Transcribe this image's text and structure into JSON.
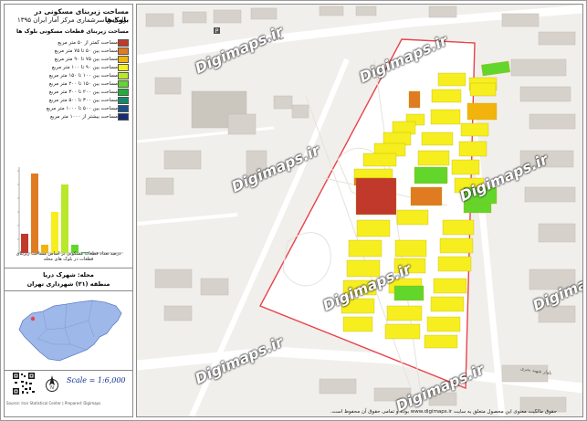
{
  "title": {
    "line1": "مساحت زیربنای مسکونی در بلوک‌ها",
    "line2": "براساس سرشماری مرکز آمار ایران ۱۳۹۵"
  },
  "legend": {
    "title": "مساحت زیربنای قطعات مسکونی بلوک ها",
    "items": [
      {
        "label": "مساحت کمتر از ۵۰ متر مربع",
        "color": "#c0392b"
      },
      {
        "label": "مساحت بین ۵۰ تا ۷۵ متر مربع",
        "color": "#e07b21"
      },
      {
        "label": "مساحت بین ۷۵ تا ۹۰ متر مربع",
        "color": "#f2b40c"
      },
      {
        "label": "مساحت بین ۹۰ تا ۱۰۰ متر مربع",
        "color": "#f6ee1e"
      },
      {
        "label": "مساحت بین ۱۰۰ تا ۱۵۰ متر مربع",
        "color": "#b9e82a"
      },
      {
        "label": "مساحت بین ۱۵۰ تا ۲۰۰ متر مربع",
        "color": "#63d62b"
      },
      {
        "label": "مساحت بین ۲۰۰ تا ۳۰۰ متر مربع",
        "color": "#1fae3a"
      },
      {
        "label": "مساحت بین ۳۰۰ تا ۵۰۰ متر مربع",
        "color": "#128a6a"
      },
      {
        "label": "مساحت بین ۵۰۰ تا ۱۰۰۰ متر مربع",
        "color": "#1a4f8c"
      },
      {
        "label": "مساحت بیشتر از ۱۰۰۰ متر مربع",
        "color": "#152c6e"
      }
    ]
  },
  "chart_data": {
    "type": "bar",
    "categories": [
      "<50",
      "50-75",
      "75-90",
      "90-100",
      "100-150",
      "150-200",
      "200-300",
      "300-500",
      "500-1000",
      ">1000"
    ],
    "values": [
      7,
      29,
      3,
      15,
      25,
      3,
      0.3,
      0,
      0,
      0
    ],
    "colors": [
      "#c0392b",
      "#e07b21",
      "#f2b40c",
      "#f6ee1e",
      "#b9e82a",
      "#63d62b",
      "#1fae3a",
      "#128a6a",
      "#1a4f8c",
      "#152c6e"
    ],
    "caption": "درصد تعداد قطعات مسکونی بر اساس مساحت زیربنای قطعات در بلوک های محله"
  },
  "district": {
    "line1": "محله: شهرک دریا",
    "line2": "منطقه (۲۱) شهرداری تهران"
  },
  "scale_text": "Scale = 1:6,000",
  "panel_credit": "Source: Iran Statistical Center | Prepared: Digimaps",
  "bottom_credit": "حقوق مالکیت معنوی این محصول متعلق به سایت www.digimaps.ir بوده و تمامی حقوق آن محفوظ است.",
  "watermark": "Digimaps.ir",
  "map_labels": {
    "street1": "بلوار شهید بحری",
    "street2": "خیابان دریا"
  },
  "colors": {
    "boundary": "#e8434a",
    "background": "#f1efeb",
    "building": "#d9d5cf",
    "inside": "#ffffff"
  }
}
